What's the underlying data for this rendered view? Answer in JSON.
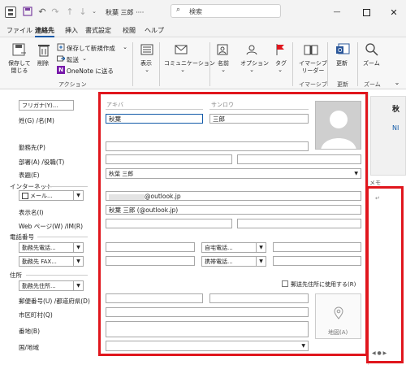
{
  "titlebar": {
    "window_title": "秋葉 三郎 ····",
    "search_placeholder": "検索"
  },
  "menu": {
    "file": "ファイル",
    "contact": "連絡先",
    "insert": "挿入",
    "format": "書式設定",
    "review": "校閲",
    "help": "ヘルプ"
  },
  "ribbon": {
    "save_close": "保存して\n閉じる",
    "delete": "削除",
    "save_new": "保存して新規作成",
    "forward": "転送",
    "onenote": "OneNote に送る",
    "show": "表示",
    "communication": "コミュニケーション",
    "names": "名前",
    "options": "オプション",
    "tags": "タグ",
    "immersive_reader": "イマーシブ\nリーダー",
    "update": "更新",
    "zoom": "ズーム",
    "group_actions": "アクション",
    "group_immersive": "イマーシブ",
    "group_update": "更新",
    "group_zoom": "ズーム"
  },
  "form": {
    "furigana_btn": "フリガナ(Y)...",
    "name_label": "姓(G) /名(M)",
    "last_name_kana": "アキバ",
    "first_name_kana": "サンロウ",
    "last_name": "秋葉",
    "first_name": "三郎",
    "company_label": "勤務先(P)",
    "dept_label": "部署(A) /役職(T)",
    "display_as_label": "表題(E)",
    "display_as": "秋葉 三郎",
    "internet_label": "インターネット",
    "email_dropdown": "メール...",
    "email": "@outlook.jp",
    "display_name_label": "表示名(I)",
    "display_name": "秋葉 三郎 (@outlook.jp)",
    "webpage_label": "Web ページ(W) /IM(R)",
    "phone_header": "電話番号",
    "phone1": "勤務先電話...",
    "phone2": "勤務先 FAX...",
    "phone3": "自宅電話...",
    "phone4": "携帯電話...",
    "address_header": "住所",
    "address_type": "勤務先住所...",
    "mailing_checkbox": "郵送先住所に使用する(R)",
    "postal_label": "郵便番号(U) /都道府県(D)",
    "city_label": "市区町村(Q)",
    "street_label": "番地(B)",
    "country_label": "国/地域",
    "map_button": "地図(A)"
  },
  "side": {
    "card_name": "秋",
    "card_link": "NI",
    "memo": "メモ",
    "return_mark": "↵"
  },
  "colors": {
    "accent": "#125aa8",
    "highlight": "#e0161d"
  }
}
